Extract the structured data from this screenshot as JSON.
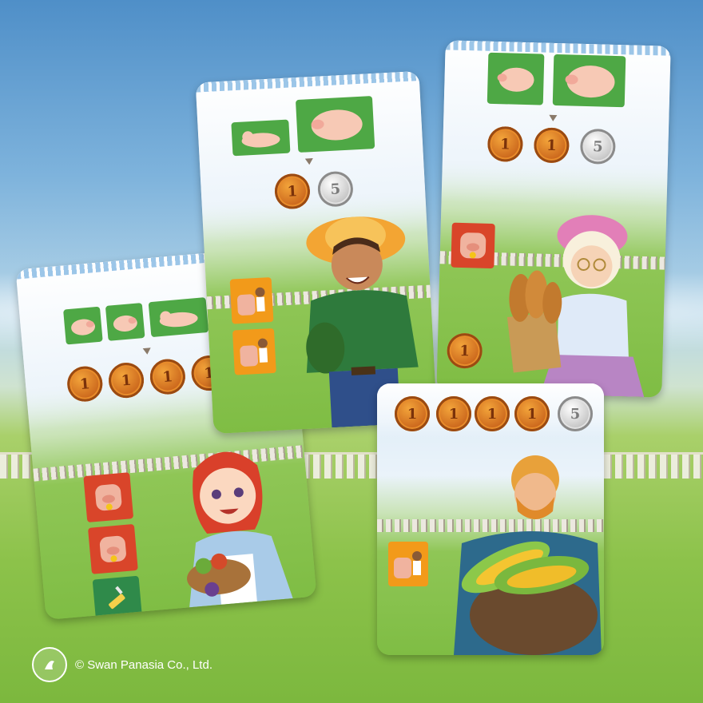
{
  "coin_values": {
    "gold": "1",
    "silver": "5"
  },
  "copyright": "© Swan Panasia Co., Ltd.",
  "colors": {
    "sky": "#5a95cc",
    "grass": "#86c046",
    "coin_gold": "#e08a2a",
    "coin_silver": "#c9c9c9",
    "tile_green": "#4ea845",
    "tile_orange": "#f29a1a",
    "tile_red": "#d9452a"
  },
  "cards": [
    {
      "id": "farmer",
      "character": "young farmer with straw hat holding watermelon",
      "pig_tiles": 2,
      "coins": [
        "1",
        "5"
      ],
      "action_tiles": 2
    },
    {
      "id": "grandma",
      "character": "grandmother with bread basket",
      "pig_tiles": 2,
      "coins": [
        "1",
        "1",
        "5"
      ],
      "action_tiles": 1
    },
    {
      "id": "girl",
      "character": "red-haired girl with fruit basket",
      "pig_tiles": 3,
      "coins": [
        "1",
        "1",
        "1",
        "1"
      ],
      "action_tiles": 3
    },
    {
      "id": "corn-man",
      "character": "bearded man carrying corn",
      "pig_tiles": 0,
      "coins": [
        "1",
        "1",
        "1",
        "5"
      ],
      "action_tiles": 1
    }
  ]
}
